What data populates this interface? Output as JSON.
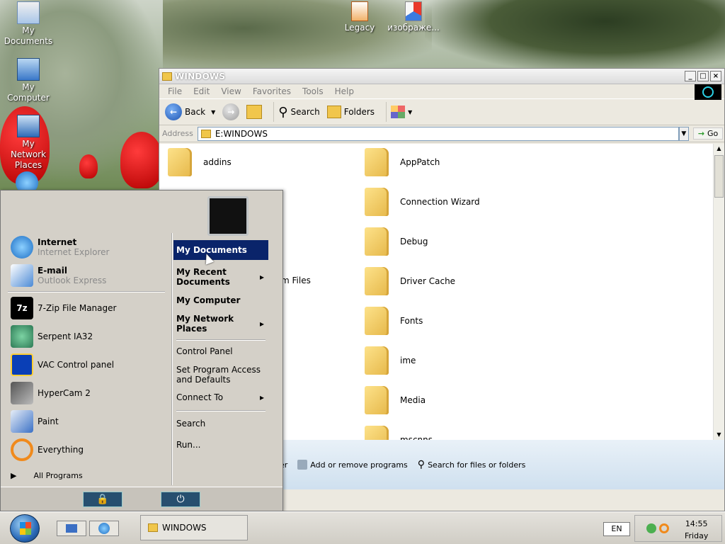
{
  "desktop": {
    "icons": [
      {
        "label": "My Documents"
      },
      {
        "label": "My Computer"
      },
      {
        "label": "My Network Places"
      },
      {
        "label": "Legacy"
      },
      {
        "label": "изображе..."
      }
    ]
  },
  "window": {
    "title": "WINDOWS",
    "menu": [
      "File",
      "Edit",
      "View",
      "Favorites",
      "Tools",
      "Help"
    ],
    "toolbar": {
      "back": "Back",
      "search": "Search",
      "folders": "Folders"
    },
    "address": {
      "label": "Address",
      "value": "E:WINDOWS",
      "go": "Go"
    },
    "folders": [
      "addins",
      "AppPatch",
      "Connection Wizard",
      "Debug",
      "m Files",
      "Driver Cache",
      "Fonts",
      "ime",
      "Media",
      "mscnns"
    ],
    "tasks": [
      "er",
      "Add or remove programs",
      "Search for files or folders"
    ]
  },
  "start_menu": {
    "pinned": [
      {
        "title": "Internet",
        "subtitle": "Internet Explorer"
      },
      {
        "title": "E-mail",
        "subtitle": "Outlook Express"
      }
    ],
    "recent": [
      "7-Zip File Manager",
      "Serpent IA32",
      "VAC Control panel",
      "HyperCam 2",
      "Paint",
      "Everything"
    ],
    "all_programs": "All Programs",
    "right": {
      "my_documents": "My Documents",
      "my_recent": "My Recent Documents",
      "my_computer": "My Computer",
      "my_network": "My Network Places",
      "control_panel": "Control Panel",
      "set_program": "Set Program Access and Defaults",
      "connect_to": "Connect To",
      "search": "Search",
      "run": "Run..."
    }
  },
  "taskbar": {
    "task": "WINDOWS",
    "lang": "EN",
    "time": "14:55",
    "day": "Friday"
  },
  "colors": {
    "selection": "#0a246a",
    "orb": "#2a6ab8"
  }
}
